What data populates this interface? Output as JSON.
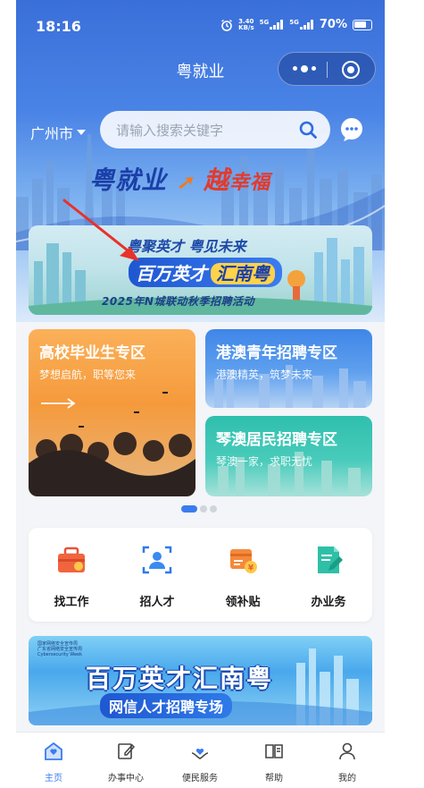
{
  "status_bar": {
    "time": "18:16",
    "net_speed": "3.40",
    "net_unit": "KB/s",
    "sim1": "5G",
    "sim2": "5G",
    "battery": "70%"
  },
  "header": {
    "title": "粤就业",
    "city": "广州市",
    "search_placeholder": "请输入搜索关键字"
  },
  "slogan": {
    "part1": "粤就业",
    "part2": "越",
    "part3": "幸福"
  },
  "banner1": {
    "top": "粤聚英才 粤见未来",
    "main": "百万英才",
    "main_alt": "汇南粤",
    "sub": "2025年N城联动秋季招聘活动"
  },
  "zones": [
    {
      "title": "高校毕业生专区",
      "subtitle": "梦想启航，职等您来"
    },
    {
      "title": "港澳青年招聘专区",
      "subtitle": "港澳精英，筑梦未来"
    },
    {
      "title": "琴澳居民招聘专区",
      "subtitle": "琴澳一家，求职无忧"
    }
  ],
  "services": [
    {
      "label": "找工作",
      "icon": "briefcase-icon"
    },
    {
      "label": "招人才",
      "icon": "person-scan-icon"
    },
    {
      "label": "领补贴",
      "icon": "subsidy-icon"
    },
    {
      "label": "办业务",
      "icon": "document-edit-icon"
    }
  ],
  "banner2": {
    "org1": "国家网络安全宣传周",
    "org2": "广东省网络安全宣传周",
    "org3": "Cybersecurity Week",
    "title": "百万英才汇南粤",
    "subtitle": "网信人才招聘专场"
  },
  "tabbar": [
    {
      "label": "主页",
      "icon": "home-icon",
      "active": true
    },
    {
      "label": "办事中心",
      "icon": "edit-square-icon",
      "active": false
    },
    {
      "label": "便民服务",
      "icon": "heart-hands-icon",
      "active": false
    },
    {
      "label": "帮助",
      "icon": "book-icon",
      "active": false
    },
    {
      "label": "我的",
      "icon": "user-icon",
      "active": false
    }
  ],
  "colors": {
    "primary": "#3a7cf0",
    "orange": "#f59a3c",
    "teal": "#2fbfad",
    "red": "#e23a2c"
  }
}
